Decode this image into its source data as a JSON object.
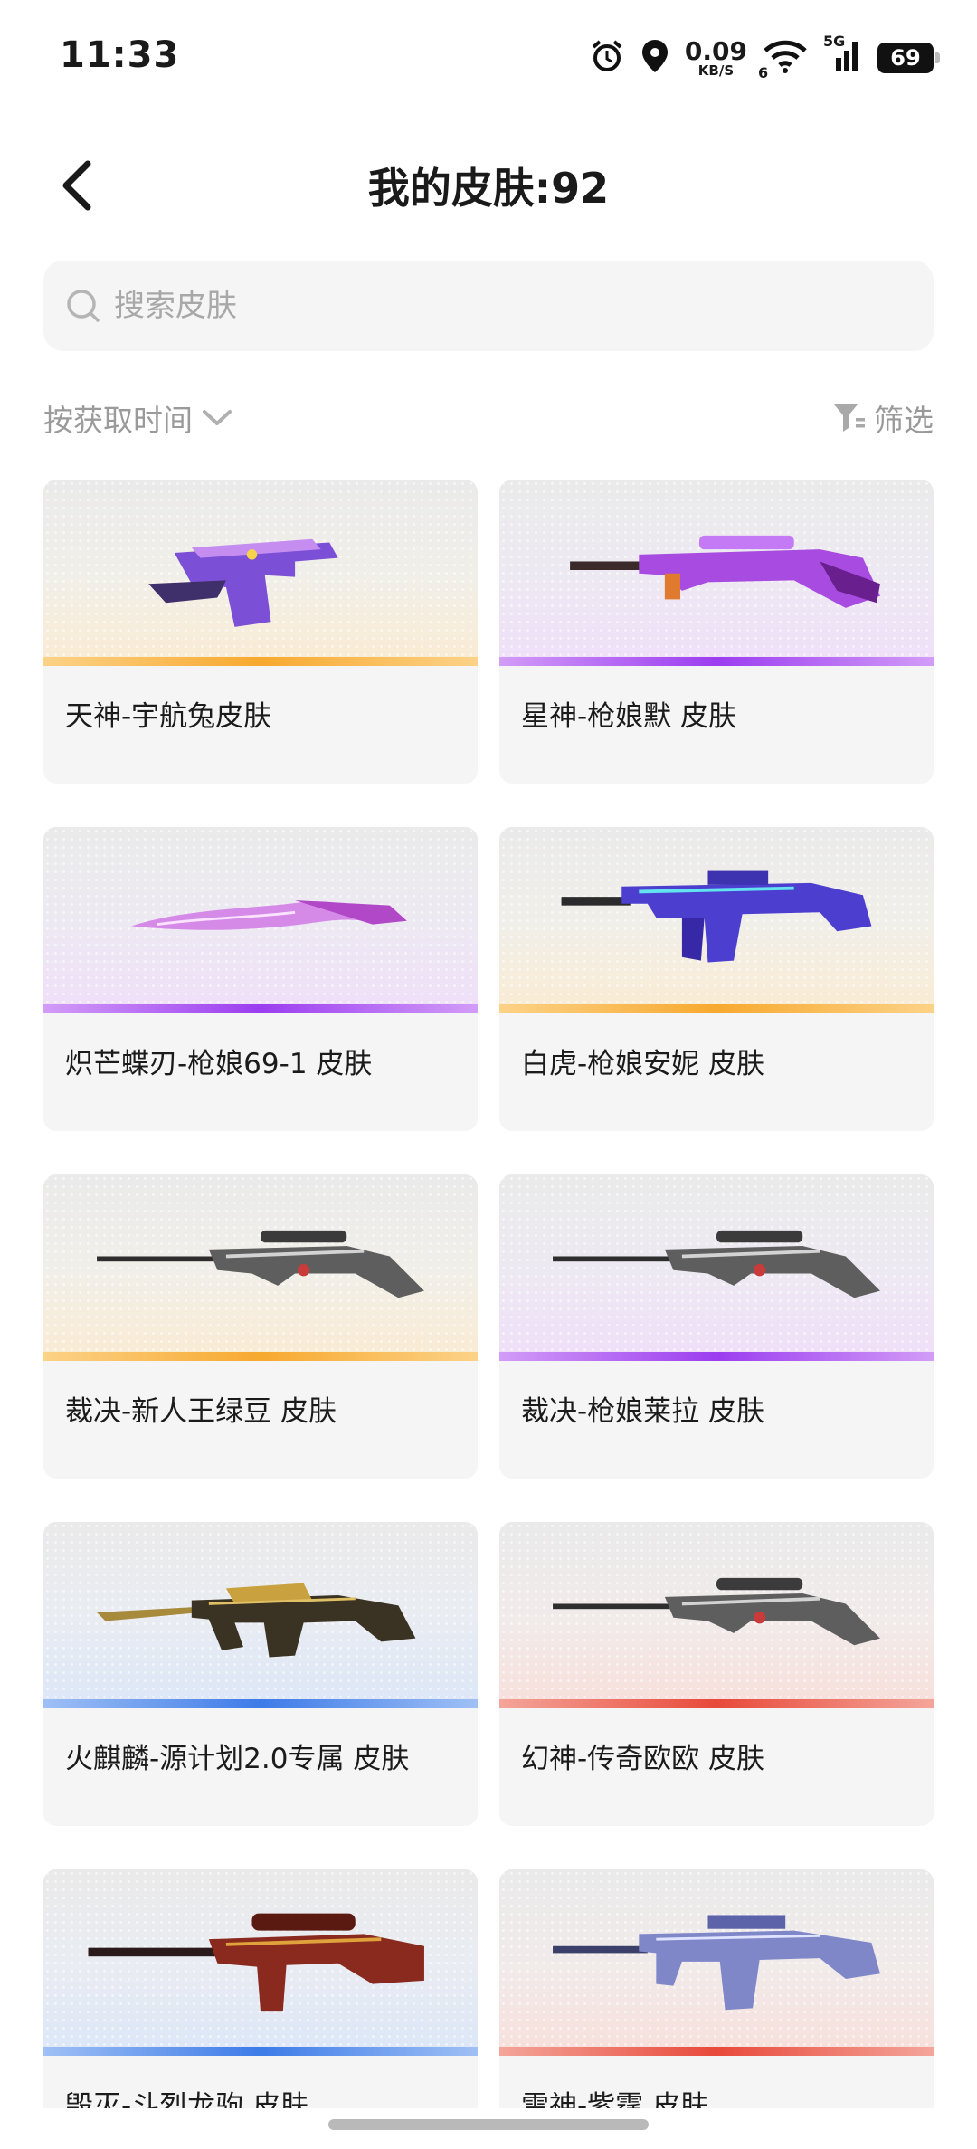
{
  "status_bar": {
    "time": "11:33",
    "net_speed": "0.09",
    "net_unit": "KB/S",
    "wifi_sub": "6",
    "cell_type": "5G",
    "battery": "69"
  },
  "header": {
    "title": "我的皮肤:92"
  },
  "search": {
    "placeholder": "搜索皮肤"
  },
  "sort": {
    "label": "按获取时间"
  },
  "filter": {
    "label": "筛选"
  },
  "colors": {
    "gold": "#f7a92f",
    "purple": "#9b3df0",
    "blue": "#3d7be8",
    "red": "#e8493a"
  },
  "skins": [
    {
      "name": "天神-宇航兔皮肤",
      "rarity": "gold",
      "weapon": "pistol"
    },
    {
      "name": "星神-枪娘默 皮肤",
      "rarity": "purple",
      "weapon": "rifle"
    },
    {
      "name": "炽芒蝶刃-枪娘69-1 皮肤",
      "rarity": "purple",
      "weapon": "knife"
    },
    {
      "name": "白虎-枪娘安妮 皮肤",
      "rarity": "gold",
      "weapon": "assault-rifle"
    },
    {
      "name": "裁决-新人王绿豆 皮肤",
      "rarity": "gold",
      "weapon": "sniper"
    },
    {
      "name": "裁决-枪娘莱拉 皮肤",
      "rarity": "purple",
      "weapon": "sniper"
    },
    {
      "name": "火麒麟-源计划2.0专属 皮肤",
      "rarity": "blue",
      "weapon": "ak"
    },
    {
      "name": "幻神-传奇欧欧 皮肤",
      "rarity": "red",
      "weapon": "sniper"
    },
    {
      "name": "毁灭-斗烈龙驹 皮肤",
      "rarity": "blue",
      "weapon": "heavy-sniper"
    },
    {
      "name": "雷神-紫霆 皮肤",
      "rarity": "red",
      "weapon": "m4"
    }
  ]
}
